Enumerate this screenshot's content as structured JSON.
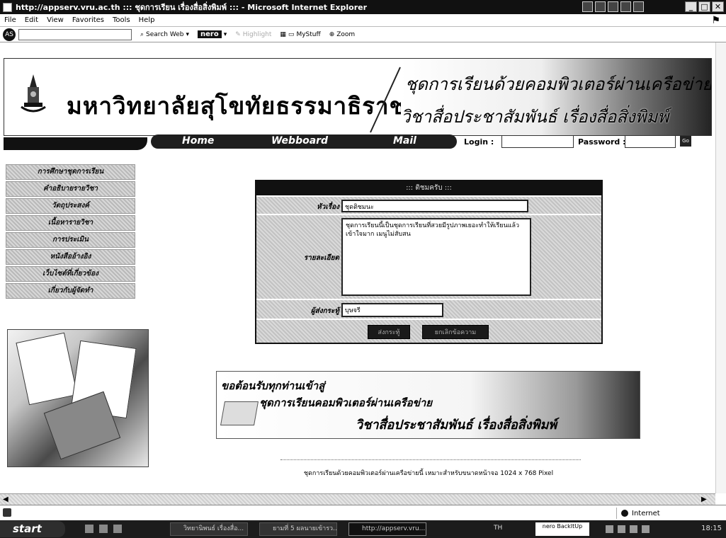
{
  "window": {
    "title": "http://appserv.vru.ac.th  ::: ชุดการเรียน  เรื่องสื่อสิ่งพิมพ์ ::: - Microsoft Internet Explorer",
    "minimize": "_",
    "maximize": "□",
    "close": "✕"
  },
  "menu": {
    "items": [
      "File",
      "Edit",
      "View",
      "Favorites",
      "Tools",
      "Help"
    ]
  },
  "toolbar": {
    "ask_label": "AS",
    "search_web": "Search Web",
    "nero": "nero",
    "highlight": "Highlight",
    "mystuff": "MyStuff",
    "zoom": "Zoom"
  },
  "banner": {
    "university": "มหาวิทยาลัยสุโขทัยธรรมาธิราช",
    "course_line1": "ชุดการเรียนด้วยคอมพิวเตอร์ผ่านเครือข่าย",
    "course_line2": "วิชาสื่อประชาสัมพันธ์ เรื่องสื่อสิ่งพิมพ์"
  },
  "nav": {
    "home": "Home",
    "webboard": "Webboard",
    "mail": "Mail",
    "login_label": "Login :",
    "password_label": "Password :",
    "go_label": "Go"
  },
  "sidebar": {
    "items": [
      {
        "label": "การศึกษาชุดการเรียน"
      },
      {
        "label": "คำอธิบายรายวิชา"
      },
      {
        "label": "วัตถุประสงค์"
      },
      {
        "label": "เนื้อหารายวิชา"
      },
      {
        "label": "การประเมิน"
      },
      {
        "label": "หนังสืออ้างอิง"
      },
      {
        "label": "เว็บไซต์ที่เกี่ยวข้อง"
      },
      {
        "label": "เกี่ยวกับผู้จัดทำ"
      }
    ]
  },
  "form": {
    "header": "::: ติชมครับ :::",
    "subject_label": "หัวเรื่อง",
    "subject_value": "ชุดติชมนะ",
    "detail_label": "รายละเอียด",
    "detail_value": "ชุดการเรียนนี้เป็นชุดการเรียนที่สวยมีรูปภาพเยอะทำให้เรียนแล้วเข้าใจมาก เมนูไม่สับสน",
    "sender_label": "ผู้ส่งกระทู้",
    "sender_value": "บุษจรี",
    "submit_label": "ส่งกระทู้",
    "reset_label": "ยกเลิกข้อความ"
  },
  "welcome": {
    "line1": "ขอต้อนรับทุกท่านเข้าสู่",
    "line2": "ชุดการเรียนคอมพิวเตอร์ผ่านเครือข่าย",
    "line3": "วิชาสื่อประชาสัมพันธ์ เรื่องสื่อสิ่งพิมพ์"
  },
  "footnote": "ชุดการเรียนด้วยคอมพิวเตอร์ผ่านเครือข่ายนี้ เหมาะสำหรับขนาดหน้าจอ 1024 x 768 Pixel",
  "statusbar": {
    "zone": "Internet"
  },
  "taskbar": {
    "start": "start",
    "tasks": [
      {
        "label": "วิทยานิพนธ์ เรื่องสื่อ..."
      },
      {
        "label": "ยามที่ 5 ผลนายเข้ารว..."
      },
      {
        "label": "http://appserv.vru..."
      }
    ],
    "lang": "TH",
    "nero_tray": "nero BackItUp",
    "clock": "18:15"
  }
}
